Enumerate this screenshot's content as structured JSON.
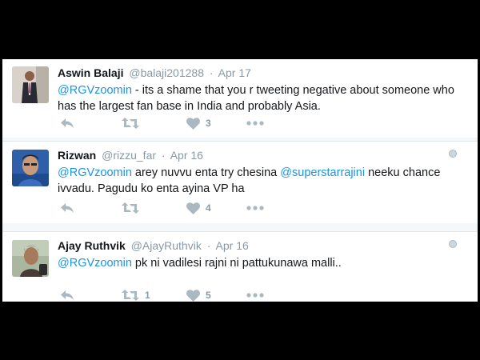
{
  "tweets": [
    {
      "name": "Aswin Balaji",
      "handle": "@balaji201288",
      "date": "Apr 17",
      "text_parts": [
        {
          "type": "mention",
          "text": "@RGVzoomin"
        },
        {
          "type": "text",
          "text": " - its a shame that you r tweeting negative about someone who has the largest fan base in India and probably Asia."
        }
      ],
      "retweets": "",
      "likes": "3",
      "avatar_icon": "profile-photo-man-suit",
      "show_globe": false
    },
    {
      "name": "Rizwan",
      "handle": "@rizzu_far",
      "date": "Apr 16",
      "text_parts": [
        {
          "type": "mention",
          "text": "@RGVzoomin"
        },
        {
          "type": "text",
          "text": " arey nuvvu enta try chesina "
        },
        {
          "type": "mention",
          "text": "@superstarrajini"
        },
        {
          "type": "text",
          "text": " neeku chance ivvadu. Pagudu ko enta ayina VP ha"
        }
      ],
      "retweets": "",
      "likes": "4",
      "avatar_icon": "profile-photo-man-blue",
      "show_globe": true
    },
    {
      "name": "Ajay Ruthvik",
      "handle": "@AjayRuthvik",
      "date": "Apr 16",
      "text_parts": [
        {
          "type": "mention",
          "text": "@RGVzoomin"
        },
        {
          "type": "text",
          "text": " pk ni vadilesi rajni ni pattukunawa malli.."
        }
      ],
      "retweets": "1",
      "likes": "5",
      "avatar_icon": "profile-photo-young-man",
      "show_globe": true
    }
  ],
  "separator": "·",
  "colors": {
    "background": "#000000",
    "card": "#ffffff",
    "mention": "#1b95e0",
    "muted": "#8899a6",
    "icon": "#aab8c2"
  },
  "icons": {
    "reply": "reply-icon",
    "retweet": "retweet-icon",
    "like": "heart-icon",
    "more": "more-dots-icon",
    "globe": "globe-icon"
  }
}
